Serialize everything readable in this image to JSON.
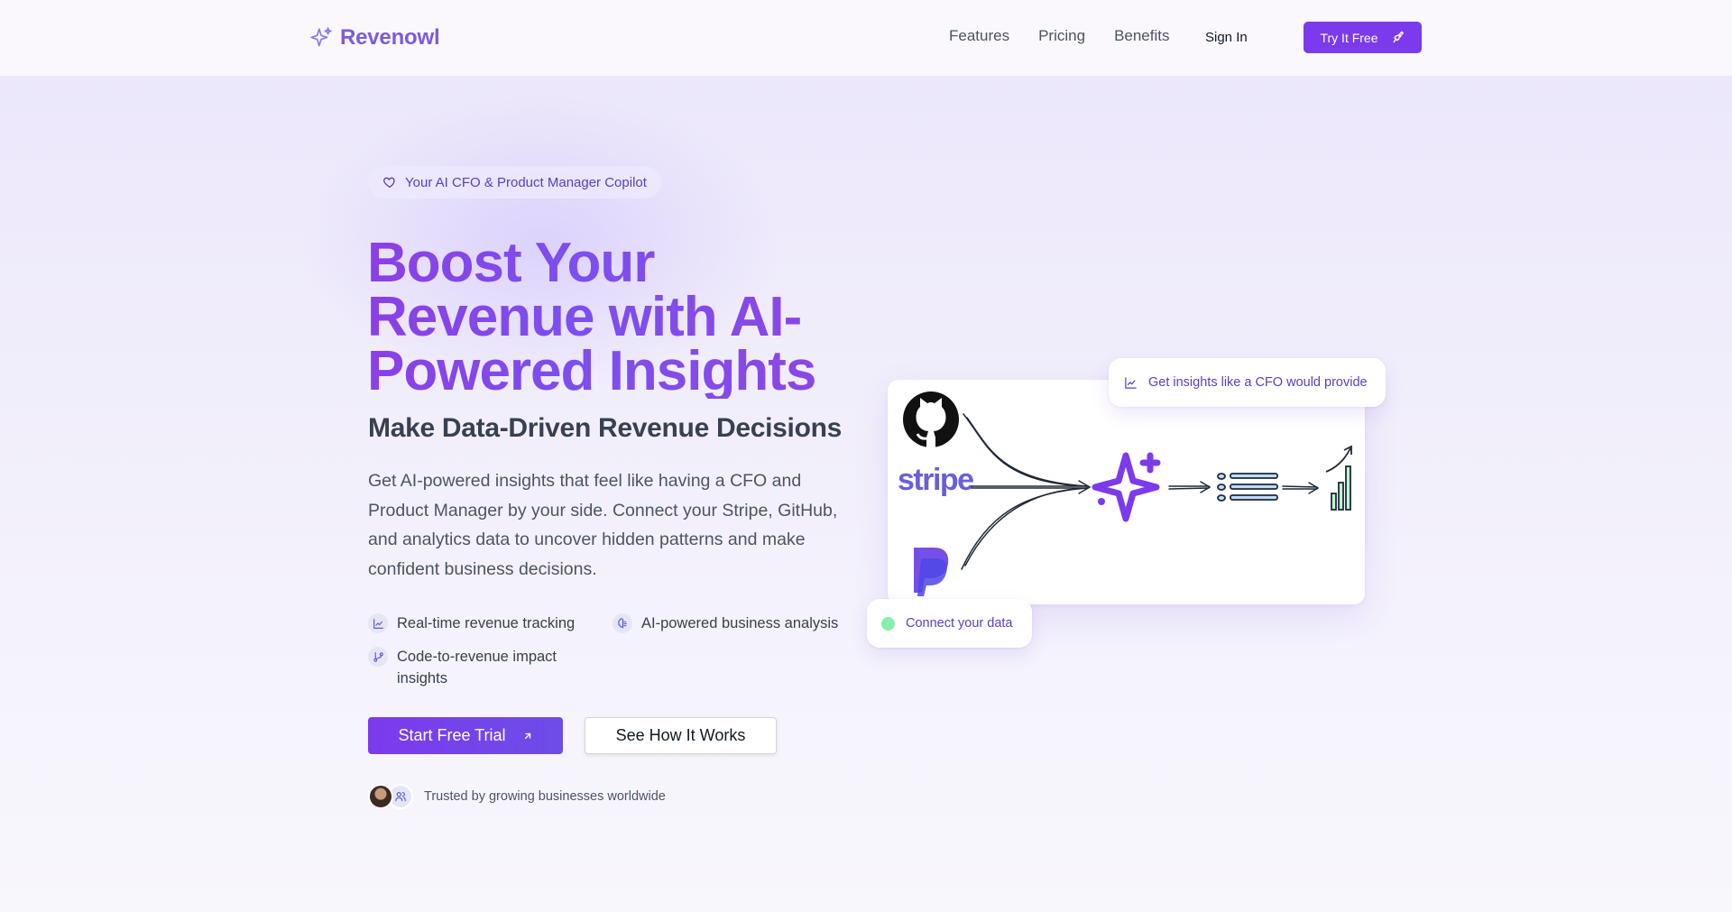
{
  "header": {
    "logo_text": "Revenowl",
    "nav": [
      "Features",
      "Pricing",
      "Benefits"
    ],
    "sign_in": "Sign In",
    "cta": "Try It Free"
  },
  "hero": {
    "badge": "Your AI CFO & Product Manager Copilot",
    "title": "Boost Your Revenue with AI-Powered Insights",
    "subtitle": "Make Data-Driven Revenue Decisions",
    "description": "Get AI-powered insights that feel like having a CFO and Product Manager by your side. Connect your Stripe, GitHub, and analytics data to uncover hidden patterns and make confident business decisions.",
    "features": [
      {
        "label": "Real-time revenue tracking",
        "icon": "chart-line-icon"
      },
      {
        "label": "AI-powered business analysis",
        "icon": "brain-icon"
      },
      {
        "label": "Code-to-revenue impact insights",
        "icon": "git-branch-icon"
      }
    ],
    "primary_cta": "Start Free Trial",
    "secondary_cta": "See How It Works",
    "trust_text": "Trusted by growing businesses worldwide"
  },
  "illustration": {
    "top_pill": "Get insights like a CFO would provide",
    "bottom_pill": "Connect your data",
    "stripe_logo": "stripe",
    "sources": [
      "github-logo",
      "stripe-logo",
      "paypal-logo"
    ],
    "accent_color": "#7c3aed",
    "status_color": "#86efac"
  },
  "colors": {
    "brand": "#7c3aed",
    "logo_text": "#7c5bdc"
  }
}
